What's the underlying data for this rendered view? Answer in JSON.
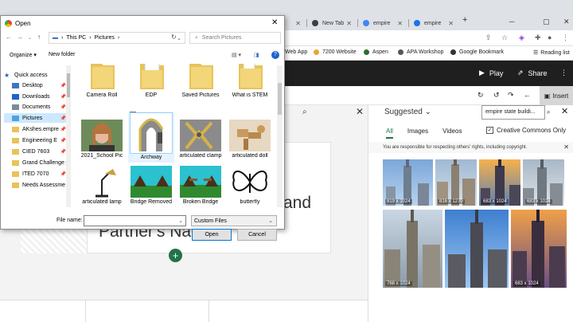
{
  "browser": {
    "tabs": [
      {
        "label": "",
        "color": "#3c4043"
      },
      {
        "label": "New Tab",
        "color": "#3c4043"
      },
      {
        "label": "empire",
        "color": "#4285f4"
      },
      {
        "label": "empire",
        "color": "#1a73e8"
      }
    ],
    "new_tab_symbol": "+",
    "bookmarks": [
      "Web App",
      "7200 Website",
      "Aspen",
      "APA Workshop",
      "Google Bookmark",
      "Reading list"
    ]
  },
  "ppt": {
    "play_label": "Play",
    "share_label": "Share",
    "insert_label": "Insert",
    "slide_text_1": "and",
    "slide_text_2": "Partner's Name"
  },
  "panel": {
    "heading": "Suggested",
    "search_value": "empire state buildi...",
    "tabs": [
      "All",
      "Images",
      "Videos"
    ],
    "cc_label": "Creative Commons Only",
    "notice": "You are responsible for respecting others' rights, including copyright.",
    "images": [
      {
        "size": "819 x 1024"
      },
      {
        "size": "816 x 1270"
      },
      {
        "size": "683 x 1024"
      },
      {
        "size": "683 x 1024"
      },
      {
        "size": "768 x 1024"
      },
      {
        "size": ""
      },
      {
        "size": "683 x 1024"
      }
    ]
  },
  "dialog": {
    "title": "Open",
    "address": [
      "This PC",
      "Pictures"
    ],
    "search_placeholder": "Search Pictures",
    "organize_label": "Organize",
    "new_folder_label": "New folder",
    "help_label": "?",
    "nav_items": [
      {
        "label": "Quick access",
        "pinned": false,
        "selected": false
      },
      {
        "label": "Desktop",
        "pinned": true,
        "selected": false
      },
      {
        "label": "Downloads",
        "pinned": true,
        "selected": false
      },
      {
        "label": "Documents",
        "pinned": true,
        "selected": false
      },
      {
        "label": "Pictures",
        "pinned": true,
        "selected": true
      },
      {
        "label": "AKshes.empre",
        "pinned": true,
        "selected": false
      },
      {
        "label": "Engineering E",
        "pinned": true,
        "selected": false
      },
      {
        "label": "CIED 7603",
        "pinned": true,
        "selected": false
      },
      {
        "label": "Grand Challenge",
        "pinned": true,
        "selected": false
      },
      {
        "label": "ITED 7070",
        "pinned": true,
        "selected": false
      },
      {
        "label": "Needs Assessme",
        "pinned": true,
        "selected": false
      }
    ],
    "files": [
      {
        "label": "Camera Roll",
        "kind": "folder"
      },
      {
        "label": "EDP",
        "kind": "folder"
      },
      {
        "label": "Saved Pictures",
        "kind": "folder"
      },
      {
        "label": "What is STEM",
        "kind": "folder"
      },
      {
        "label": "2021_School Pic",
        "kind": "portrait"
      },
      {
        "label": "Archway",
        "kind": "archway"
      },
      {
        "label": "articulated clamp",
        "kind": "clamp"
      },
      {
        "label": "articulated doll",
        "kind": "doll"
      },
      {
        "label": "articulated lamp",
        "kind": "lamp"
      },
      {
        "label": "Bridge Removed",
        "kind": "bridge"
      },
      {
        "label": "Broken Bridge",
        "kind": "bridge2"
      },
      {
        "label": "butterfly",
        "kind": "butterfly"
      }
    ],
    "filename_label": "File name:",
    "filename_value": "",
    "filetype_value": "Custom Files",
    "open_label": "Open",
    "cancel_label": "Cancel"
  }
}
